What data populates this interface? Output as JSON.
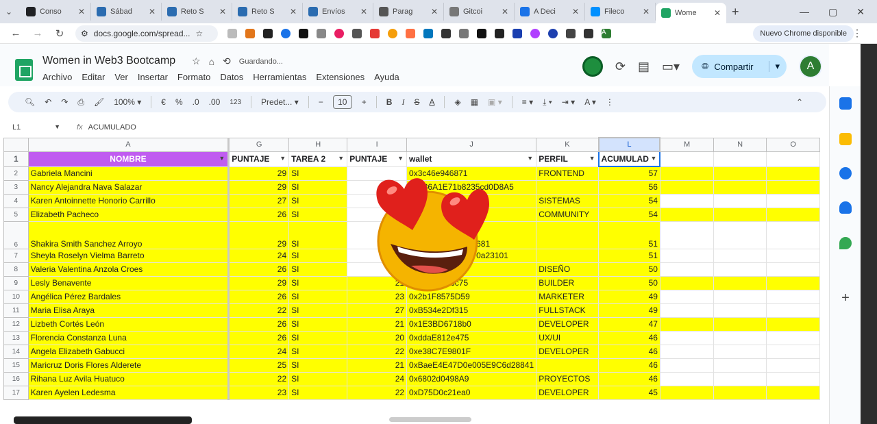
{
  "browser": {
    "tabs": [
      {
        "label": "Conso",
        "color": "#202124"
      },
      {
        "label": "Sábad",
        "color": "#2b6cb0"
      },
      {
        "label": "Reto S",
        "color": "#2b6cb0"
      },
      {
        "label": "Reto S",
        "color": "#2b6cb0"
      },
      {
        "label": "Envíos",
        "color": "#2b6cb0"
      },
      {
        "label": "Parag",
        "color": "#555555"
      },
      {
        "label": "Gitcoi",
        "color": "#777777"
      },
      {
        "label": "A Deci",
        "color": "#1a73e8"
      },
      {
        "label": "Fileco",
        "color": "#0090ff"
      },
      {
        "label": "Wome",
        "color": "#1fa463"
      }
    ],
    "url": "docs.google.com/spread...",
    "update_label": "Nuevo Chrome disponible",
    "avatar_letter": "A"
  },
  "doc": {
    "title": "Women in Web3 Bootcamp",
    "status": "Guardando...",
    "menus": [
      "Archivo",
      "Editar",
      "Ver",
      "Insertar",
      "Formato",
      "Datos",
      "Herramientas",
      "Extensiones",
      "Ayuda"
    ],
    "share_label": "Compartir",
    "avatar_letter": "A"
  },
  "toolbar": {
    "zoom": "100%",
    "currency": "€",
    "percent": "%",
    "dec_less": ".0",
    "dec_more": ".00",
    "num_format": "123",
    "font": "Predet...",
    "font_size": "10"
  },
  "formula": {
    "cell": "L1",
    "value": "ACUMULADO"
  },
  "sheet": {
    "columns": [
      "A",
      "G",
      "H",
      "I",
      "J",
      "K",
      "L",
      "M",
      "N",
      "O"
    ],
    "headers": [
      "NOMBRE",
      "PUNTAJE",
      "TAREA 2",
      "PUNTAJE",
      "wallet",
      "PERFIL",
      "ACUMULAD"
    ],
    "rows": [
      {
        "n": "2",
        "name": "Gabriela Mancini",
        "p1": "29",
        "t2": "SI",
        "p2": "",
        "wallet": "0x3c46e946871",
        "perfil": "FRONTEND",
        "acum": "57",
        "rest": true
      },
      {
        "n": "3",
        "name": "Nancy Alejandra Nava Salazar",
        "p1": "29",
        "t2": "SI",
        "p2": "",
        "wallet": "0xE36A1E71b8235cd0D8A5",
        "perfil": "",
        "acum": "56",
        "rest": true
      },
      {
        "n": "4",
        "name": "Karen Antoinnette Honorio Carrillo",
        "p1": "27",
        "t2": "SI",
        "p2": "",
        "wallet": "...Edbe",
        "perfil": "SISTEMAS",
        "acum": "54",
        "rest": false
      },
      {
        "n": "5",
        "name": "Elizabeth Pacheco",
        "p1": "26",
        "t2": "SI",
        "p2": "",
        "wallet": "...32",
        "perfil": "COMMUNITY",
        "acum": "54",
        "rest": true
      },
      {
        "n": "6",
        "name": "Shakira Smith Sanchez Arroyo",
        "p1": "29",
        "t2": "SI",
        "p2": "",
        "wallet": "...A390f06409fb8b681",
        "perfil": "",
        "acum": "51",
        "rest": false
      },
      {
        "n": "7",
        "name": "Sheyla Roselyn Vielma Barreto",
        "p1": "24",
        "t2": "SI",
        "p2": "",
        "wallet": "...26F89DB1f72bF0a23101",
        "perfil": "",
        "acum": "51",
        "rest": false
      },
      {
        "n": "8",
        "name": "Valeria Valentina Anzola Croes",
        "p1": "26",
        "t2": "SI",
        "p2": "",
        "wallet": "...9E33BF83",
        "perfil": "DISEÑO",
        "acum": "50",
        "rest": false
      },
      {
        "n": "9",
        "name": "Lesly Benavente",
        "p1": "29",
        "t2": "SI",
        "p2": "21",
        "wallet": "0x475c2E46c75",
        "perfil": "BUILDER",
        "acum": "50",
        "rest": true
      },
      {
        "n": "10",
        "name": "Angélica Pérez Bardales",
        "p1": "26",
        "t2": "SI",
        "p2": "23",
        "wallet": "0x2b1F8575D59",
        "perfil": "MARKETER",
        "acum": "49",
        "rest": false
      },
      {
        "n": "11",
        "name": "Maria Elisa Araya",
        "p1": "22",
        "t2": "SI",
        "p2": "27",
        "wallet": "0xB534e2Df315",
        "perfil": "FULLSTACK",
        "acum": "49",
        "rest": false
      },
      {
        "n": "12",
        "name": "Lizbeth Cortés León",
        "p1": "26",
        "t2": "SI",
        "p2": "21",
        "wallet": "0x1E3BD6718b0",
        "perfil": "DEVELOPER",
        "acum": "47",
        "rest": true
      },
      {
        "n": "13",
        "name": "Florencia Constanza Luna",
        "p1": "26",
        "t2": "SI",
        "p2": "20",
        "wallet": "0xddaE812e475",
        "perfil": "UX/UI",
        "acum": "46",
        "rest": false
      },
      {
        "n": "14",
        "name": "Angela Elizabeth Gabucci",
        "p1": "24",
        "t2": "SI",
        "p2": "22",
        "wallet": "0xe38C7E9801F",
        "perfil": "DEVELOPER",
        "acum": "46",
        "rest": false
      },
      {
        "n": "15",
        "name": "Maricruz Doris Flores Alderete",
        "p1": "25",
        "t2": "SI",
        "p2": "21",
        "wallet": "0xBaeE4E47D0e005E9C6d28841",
        "perfil": "",
        "acum": "46",
        "rest": false
      },
      {
        "n": "16",
        "name": "Rihana Luz Avila Huatuco",
        "p1": "22",
        "t2": "SI",
        "p2": "24",
        "wallet": "0x6802d0498A9",
        "perfil": "PROYECTOS",
        "acum": "46",
        "rest": false
      },
      {
        "n": "17",
        "name": "Karen Ayelen Ledesma",
        "p1": "23",
        "t2": "SI",
        "p2": "22",
        "wallet": "0xD75D0c21ea0",
        "perfil": "DEVELOPER",
        "acum": "45",
        "rest": true
      }
    ]
  },
  "colors": {
    "highlight": "#ffff00",
    "header_name": "#c05cf0",
    "accent": "#1a73e8"
  }
}
